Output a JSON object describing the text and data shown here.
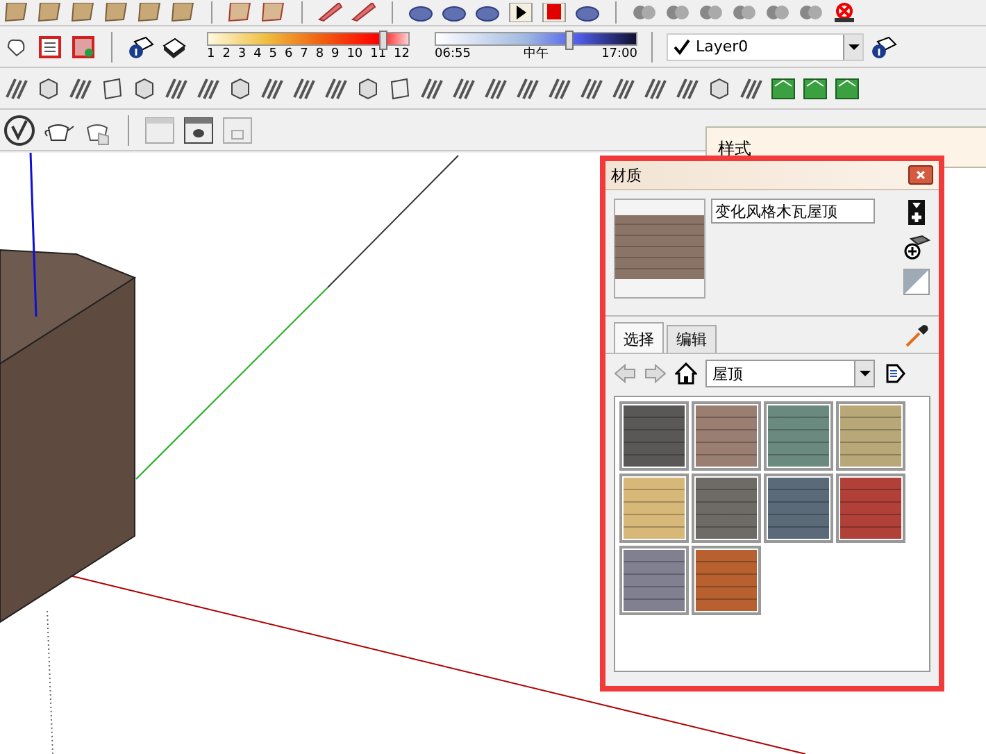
{
  "toolbars": {
    "shadow_scale": {
      "labels": [
        "1",
        "2",
        "3",
        "4",
        "5",
        "6",
        "7",
        "8",
        "9",
        "10",
        "11",
        "12"
      ],
      "level": 0.87
    },
    "time_slider": {
      "start": "06:55",
      "middle": "中午",
      "end": "17:00",
      "level": 0.66
    },
    "layer": {
      "checked": true,
      "name": "Layer0"
    }
  },
  "styles_panel": {
    "title": "样式"
  },
  "materials": {
    "title": "材质",
    "material_name": "变化风格木瓦屋顶",
    "tabs": [
      {
        "label": "选择",
        "selected": true
      },
      {
        "label": "编辑",
        "selected": false
      }
    ],
    "collection": "屋顶",
    "swatches": [
      {
        "color": "#5a5856"
      },
      {
        "color": "#9a7e72"
      },
      {
        "color": "#6a8a80"
      },
      {
        "color": "#b8a878"
      },
      {
        "color": "#d8b878"
      },
      {
        "color": "#6e6a66"
      },
      {
        "color": "#5a6a78"
      },
      {
        "color": "#b04038"
      },
      {
        "color": "#808090"
      },
      {
        "color": "#b86030"
      }
    ]
  }
}
